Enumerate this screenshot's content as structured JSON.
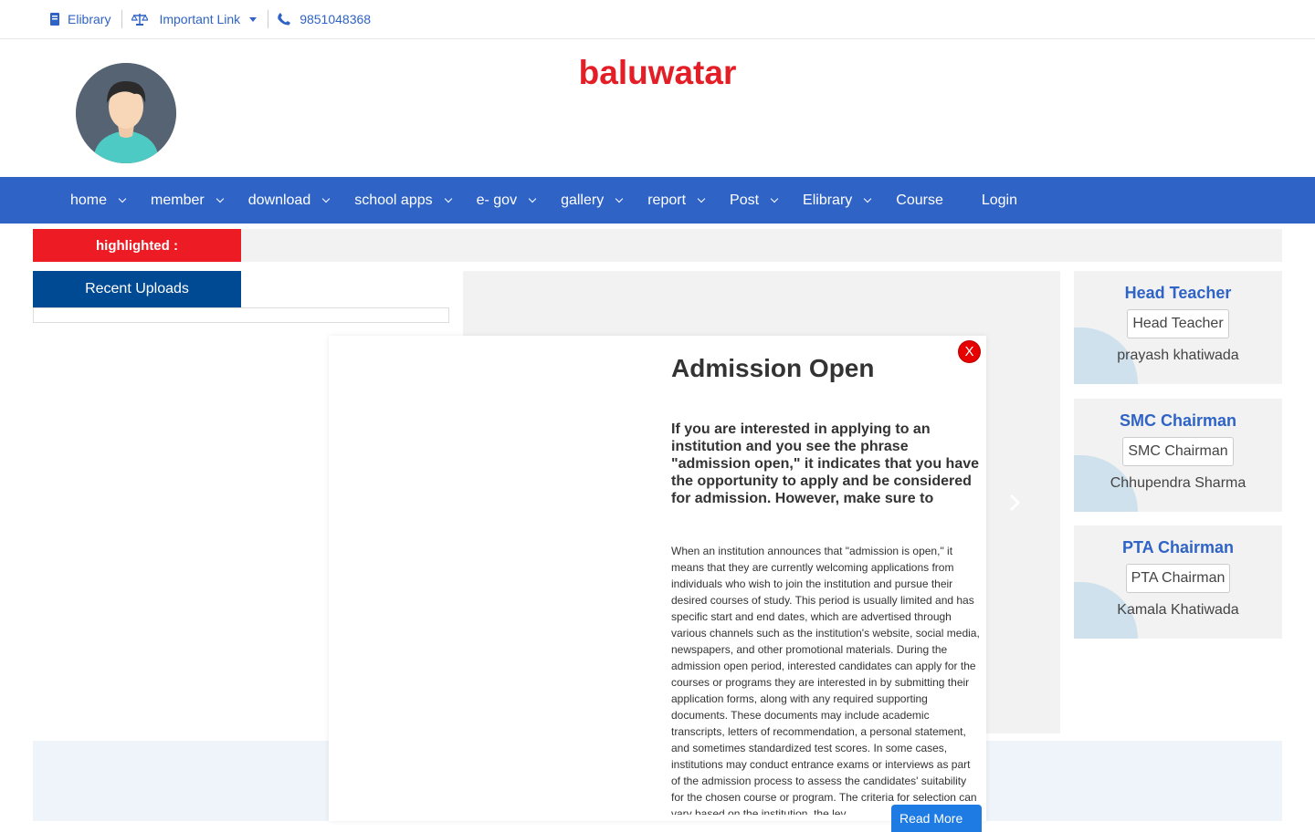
{
  "topbar": {
    "elibrary": "Elibrary",
    "important_link": "Important Link",
    "phone": "9851048368"
  },
  "header": {
    "site_title": "baluwatar"
  },
  "nav": {
    "items": [
      {
        "label": "home"
      },
      {
        "label": "member"
      },
      {
        "label": "download"
      },
      {
        "label": "school apps"
      },
      {
        "label": "e- gov"
      },
      {
        "label": "gallery"
      },
      {
        "label": "report"
      },
      {
        "label": "Post"
      },
      {
        "label": "Elibrary"
      },
      {
        "label": "Course"
      },
      {
        "label": "Login"
      }
    ]
  },
  "highlight": {
    "label": "highlighted :"
  },
  "recent": {
    "title": "Recent Uploads"
  },
  "staff": [
    {
      "role": "Head Teacher",
      "img_alt": "Head Teacher",
      "name": "prayash khatiwada"
    },
    {
      "role": "SMC Chairman",
      "img_alt": "SMC Chairman",
      "name": "Chhupendra Sharma"
    },
    {
      "role": "PTA Chairman",
      "img_alt": "PTA Chairman",
      "name": "Kamala Khatiwada"
    }
  ],
  "modal": {
    "close": "X",
    "title": "Admission Open",
    "lead": "If you are interested in applying to an institution and you see the phrase \"admission open,\" it indicates that you have the opportunity to apply and be considered for admission. However, make sure to",
    "body": "When an institution announces that \"admission is open,\" it means that they are currently welcoming applications from individuals who wish to join the institution and pursue their desired courses of study. This period is usually limited and has specific start and end dates, which are advertised through various channels such as the institution's website, social media, newspapers, and other promotional materials. During the admission open period, interested candidates can apply for the courses or programs they are interested in by submitting their application forms, along with any required supporting documents. These documents may include academic transcripts, letters of recommendation, a personal statement, and sometimes standardized test scores. In some cases, institutions may conduct entrance exams or interviews as part of the admission process to assess the candidates' suitability for the chosen course or program. The criteria for selection can vary based on the institution, the lev",
    "read_more": "Read More"
  },
  "colors": {
    "brand_blue": "#2f63c6",
    "brand_red": "#e41e26",
    "dark_blue": "#004a93"
  }
}
